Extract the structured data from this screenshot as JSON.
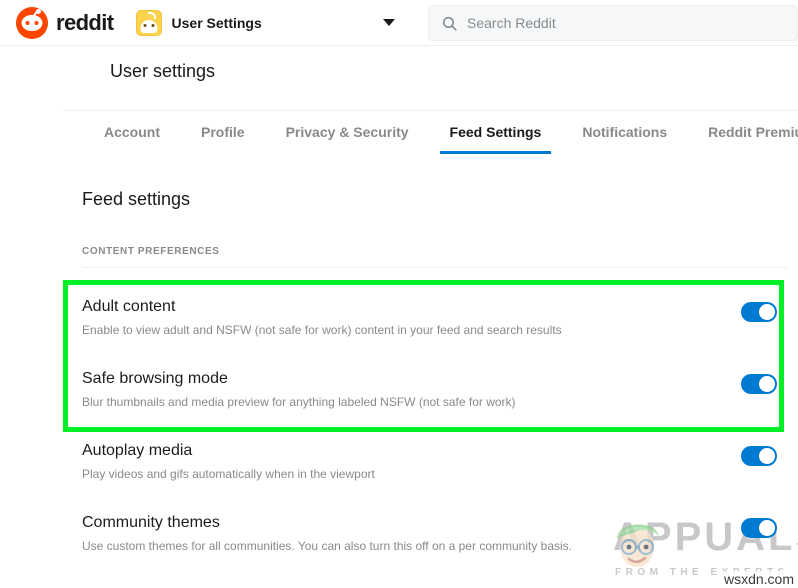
{
  "header": {
    "brand_name": "reddit",
    "brand_icon": "reddit-alien-logo",
    "avatar_icon": "snoo-avatar-icon",
    "user_dropdown_label": "User Settings",
    "chevron_icon": "chevron-down-icon",
    "search": {
      "icon": "search-icon",
      "placeholder": "Search Reddit",
      "value": ""
    }
  },
  "settings": {
    "page_title": "User settings",
    "tabs": [
      {
        "label": "Account",
        "active": false
      },
      {
        "label": "Profile",
        "active": false
      },
      {
        "label": "Privacy & Security",
        "active": false
      },
      {
        "label": "Feed Settings",
        "active": true
      },
      {
        "label": "Notifications",
        "active": false
      },
      {
        "label": "Reddit Premium",
        "active": false
      }
    ],
    "active_tab": "Feed Settings",
    "section_title": "Feed settings",
    "section_label": "CONTENT PREFERENCES",
    "rows": [
      {
        "title": "Adult content",
        "description": "Enable to view adult and NSFW (not safe for work) content in your feed and search results",
        "toggle_state": "on",
        "highlighted": true
      },
      {
        "title": "Safe browsing mode",
        "description": "Blur thumbnails and media preview for anything labeled NSFW (not safe for work)",
        "toggle_state": "on",
        "highlighted": true
      },
      {
        "title": "Autoplay media",
        "description": "Play videos and gifs automatically when in the viewport",
        "toggle_state": "on",
        "highlighted": false
      },
      {
        "title": "Community themes",
        "description": "Use custom themes for all communities. You can also turn this off on a per community basis.",
        "toggle_state": "on",
        "highlighted": false
      }
    ]
  },
  "annotation": {
    "highlight_color": "#00f028",
    "highlight_note": "green rectangle around Adult content and Safe browsing mode rows"
  },
  "watermark": {
    "brand": "APPUALS",
    "tagline": "FROM THE EXPERTS",
    "site": "wsxdn.com",
    "mascot_icon": "appuals-mascot-icon"
  },
  "colors": {
    "reddit_orange": "#ff4500",
    "accent_blue": "#0079d3",
    "text_primary": "#1a1a1b",
    "text_secondary": "#878a8c",
    "divider": "#edeff1",
    "highlight_green": "#00f028"
  }
}
